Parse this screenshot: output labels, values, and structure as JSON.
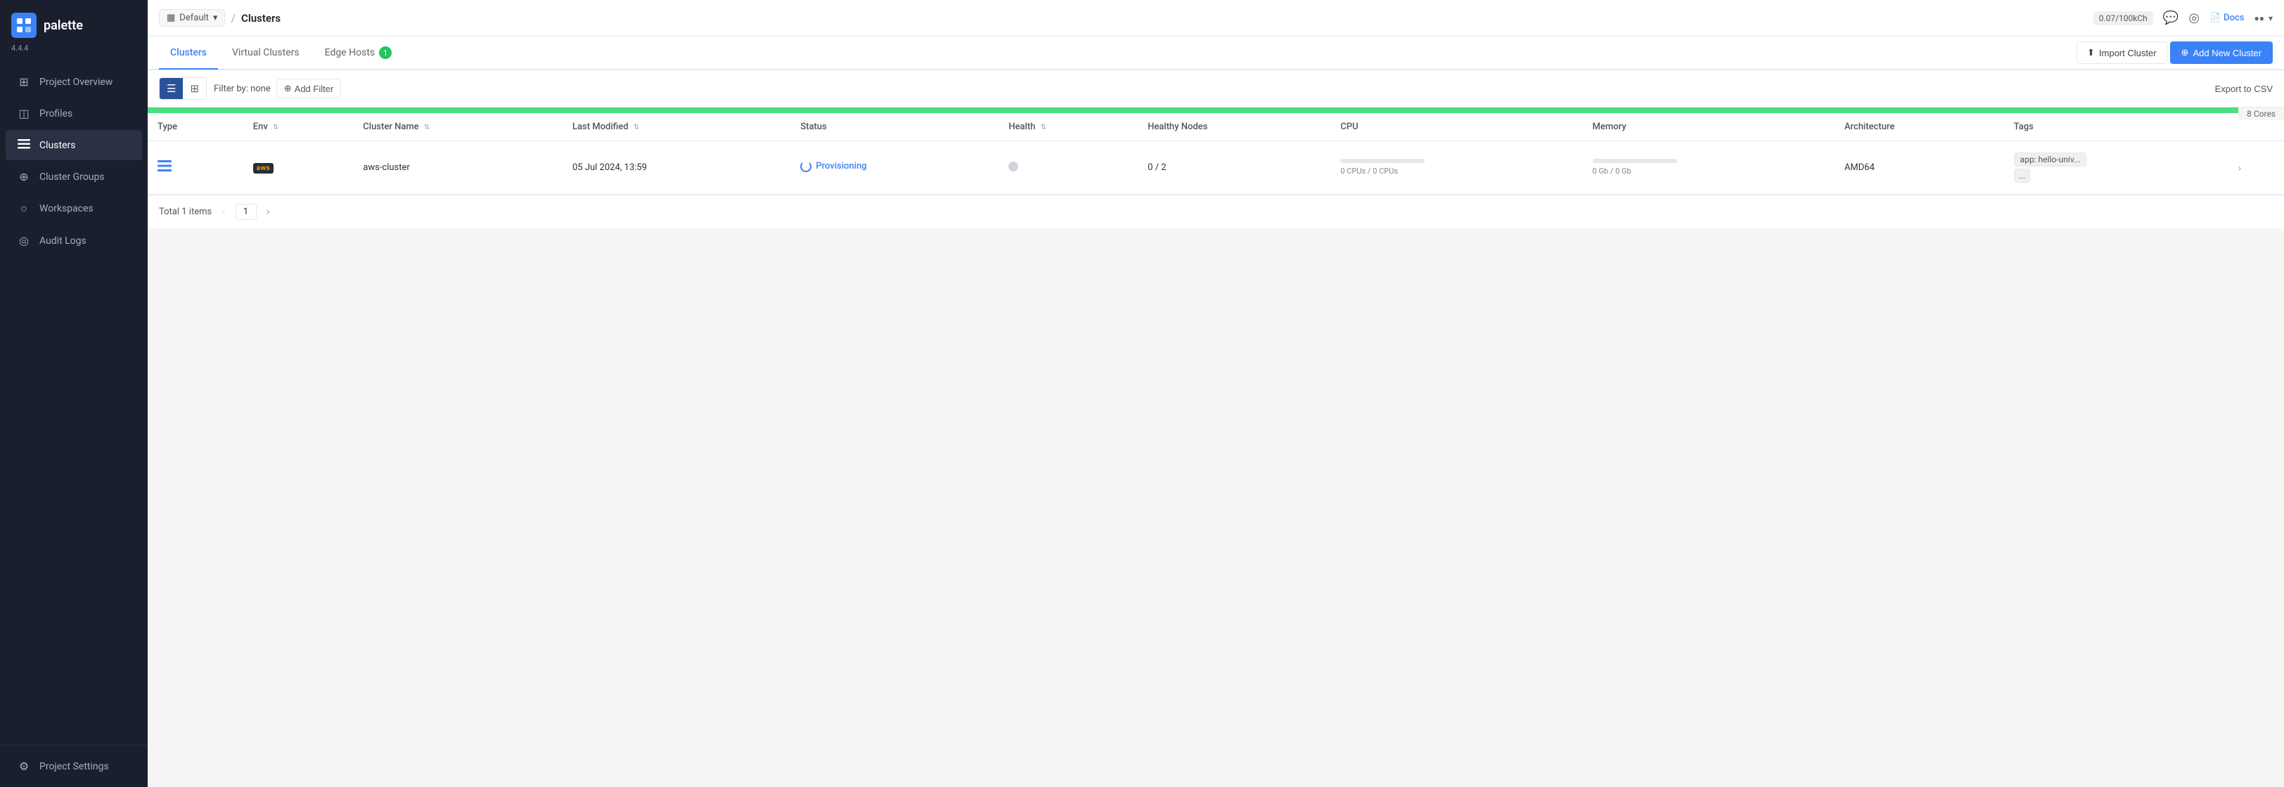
{
  "app": {
    "version": "4.4.4",
    "logo_text": "palette"
  },
  "topbar": {
    "workspace_label": "Default",
    "breadcrumb_sep": "/",
    "page_title": "Clusters",
    "usage": "0.07/100kCh",
    "docs_label": "Docs"
  },
  "tabs": [
    {
      "id": "clusters",
      "label": "Clusters",
      "active": true,
      "badge": null
    },
    {
      "id": "virtual-clusters",
      "label": "Virtual Clusters",
      "active": false,
      "badge": null
    },
    {
      "id": "edge-hosts",
      "label": "Edge Hosts",
      "active": false,
      "badge": "1"
    }
  ],
  "toolbar": {
    "filter_label": "Filter by: none",
    "add_filter_label": "Add Filter",
    "export_label": "Export to CSV"
  },
  "buttons": {
    "import_cluster": "Import Cluster",
    "add_new_cluster": "Add New Cluster"
  },
  "progress": {
    "cores_label": "8 Cores"
  },
  "table": {
    "columns": [
      {
        "id": "type",
        "label": "Type",
        "sortable": false
      },
      {
        "id": "env",
        "label": "Env",
        "sortable": true
      },
      {
        "id": "cluster_name",
        "label": "Cluster Name",
        "sortable": true
      },
      {
        "id": "last_modified",
        "label": "Last Modified",
        "sortable": true
      },
      {
        "id": "status",
        "label": "Status",
        "sortable": false
      },
      {
        "id": "health",
        "label": "Health",
        "sortable": true
      },
      {
        "id": "healthy_nodes",
        "label": "Healthy Nodes",
        "sortable": false
      },
      {
        "id": "cpu",
        "label": "CPU",
        "sortable": false
      },
      {
        "id": "memory",
        "label": "Memory",
        "sortable": false
      },
      {
        "id": "architecture",
        "label": "Architecture",
        "sortable": false
      },
      {
        "id": "tags",
        "label": "Tags",
        "sortable": false
      }
    ],
    "rows": [
      {
        "type_icon": "≡",
        "env": "aws",
        "cluster_name": "aws-cluster",
        "last_modified": "05 Jul 2024, 13:59",
        "status": "Provisioning",
        "health": "dot",
        "healthy_nodes": "0 / 2",
        "cpu_label": "0 CPUs / 0 CPUs",
        "cpu_pct": 0,
        "memory_label": "0 Gb / 0 Gb",
        "memory_pct": 0,
        "architecture": "AMD64",
        "tags": [
          "app: hello-univ..."
        ],
        "tags_more": "..."
      }
    ]
  },
  "pagination": {
    "total_label": "Total 1 items",
    "current_page": "1"
  },
  "sidebar": {
    "nav_items": [
      {
        "id": "project-overview",
        "label": "Project Overview",
        "icon": "⊞"
      },
      {
        "id": "profiles",
        "label": "Profiles",
        "icon": "◫"
      },
      {
        "id": "clusters",
        "label": "Clusters",
        "icon": "≡",
        "active": true
      },
      {
        "id": "cluster-groups",
        "label": "Cluster Groups",
        "icon": "⊕"
      },
      {
        "id": "workspaces",
        "label": "Workspaces",
        "icon": "○"
      },
      {
        "id": "audit-logs",
        "label": "Audit Logs",
        "icon": "◎"
      }
    ],
    "bottom_items": [
      {
        "id": "project-settings",
        "label": "Project Settings",
        "icon": "⚙"
      }
    ]
  }
}
